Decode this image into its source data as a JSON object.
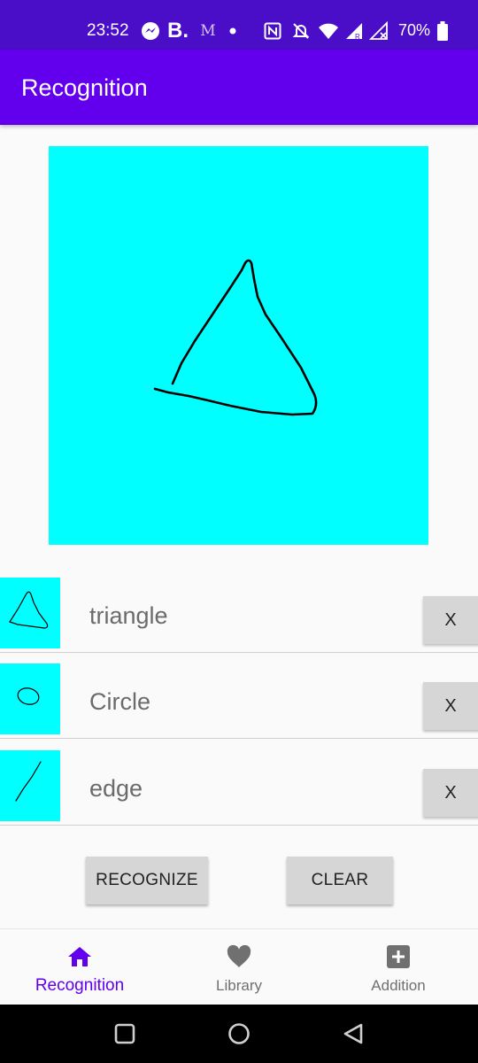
{
  "status_bar": {
    "time": "23:52",
    "battery": "70%",
    "icons": [
      "messenger-icon",
      "b-app-icon",
      "medium-icon",
      "dot-icon",
      "nfc-icon",
      "mute-icon",
      "wifi-icon",
      "signal-r-icon",
      "signal-x-icon",
      "battery-icon"
    ]
  },
  "app_bar": {
    "title": "Recognition"
  },
  "colors": {
    "primary": "#6200ee",
    "status_bar": "#4a0ec8",
    "canvas": "#00ffff",
    "button": "#d6d6d6"
  },
  "drawing_canvas": {
    "stroke": "triangle-drawing"
  },
  "gestures": [
    {
      "label": "triangle",
      "thumbnail": "triangle-thumbnail",
      "delete_label": "X"
    },
    {
      "label": "Circle",
      "thumbnail": "circle-thumbnail",
      "delete_label": "X"
    },
    {
      "label": "edge",
      "thumbnail": "edge-thumbnail",
      "delete_label": "X"
    }
  ],
  "actions": {
    "recognize": "RECOGNIZE",
    "clear": "CLEAR"
  },
  "bottom_nav": [
    {
      "label": "Recognition",
      "icon": "home-icon",
      "active": true
    },
    {
      "label": "Library",
      "icon": "heart-icon",
      "active": false
    },
    {
      "label": "Addition",
      "icon": "add-box-icon",
      "active": false
    }
  ],
  "system_nav": [
    "recents-icon",
    "home-circle-icon",
    "back-icon"
  ]
}
